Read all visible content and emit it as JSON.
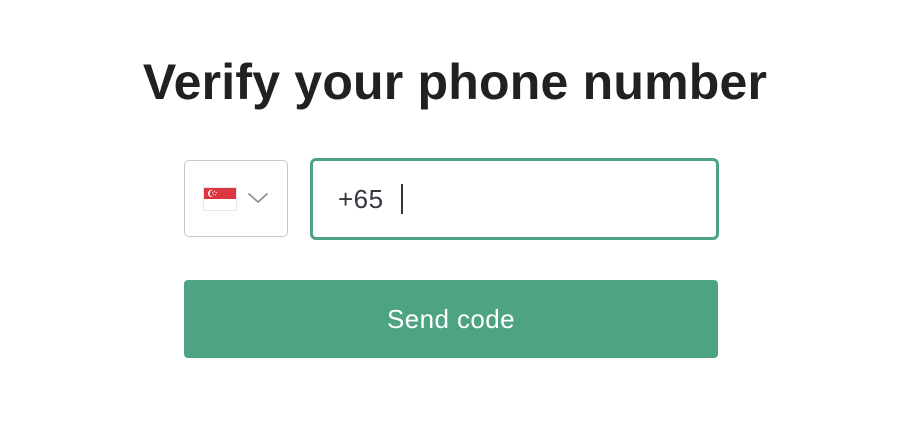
{
  "heading": {
    "title": "Verify your phone number"
  },
  "country_select": {
    "selected_country": "Singapore",
    "flag_icon": "singapore-flag-icon",
    "dropdown_icon": "chevron-down-icon"
  },
  "phone_input": {
    "value": "+65"
  },
  "actions": {
    "send_label": "Send code"
  },
  "colors": {
    "accent": "#4ea382",
    "input_focus_border": "#4ca383",
    "title_text": "#202123",
    "select_border": "#c7c7cc",
    "flag_red": "#dc3740"
  }
}
